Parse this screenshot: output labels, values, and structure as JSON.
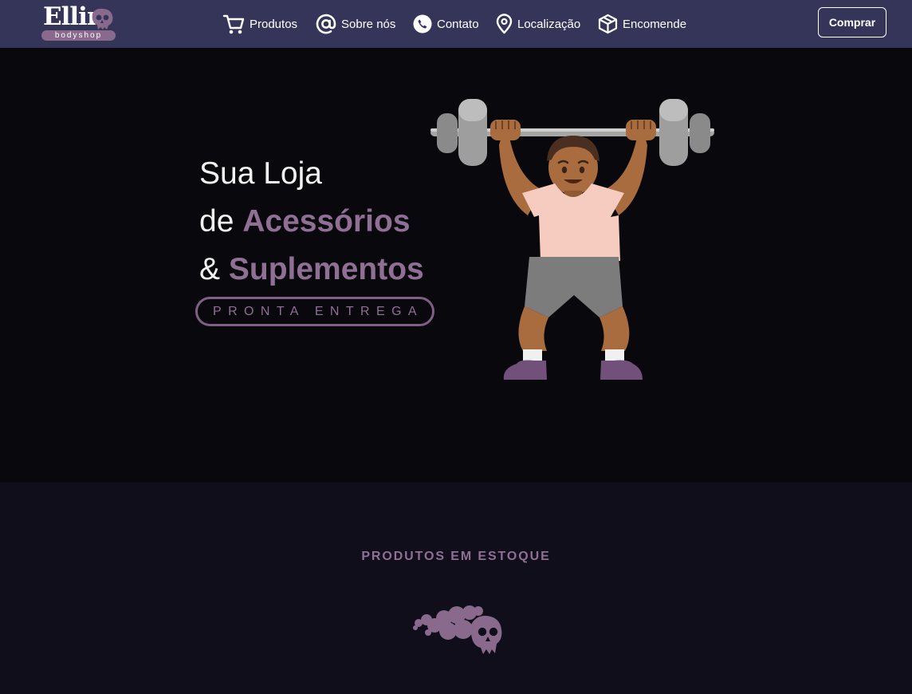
{
  "header": {
    "logo": {
      "word": "Ellin",
      "subtitle": "bodyshop"
    },
    "nav": [
      {
        "label": "Produtos",
        "icon": "shopping-cart-icon"
      },
      {
        "label": "Sobre nós",
        "icon": "at-sign-icon"
      },
      {
        "label": "Contato",
        "icon": "phone-icon"
      },
      {
        "label": "Localização",
        "icon": "map-pin-icon"
      },
      {
        "label": "Encomende",
        "icon": "package-icon"
      }
    ],
    "buy_label": "Comprar"
  },
  "hero": {
    "line1": "Sua Loja",
    "line2_prefix": "de",
    "line2_accent": "Acessórios",
    "line3_prefix": "&",
    "line3_accent": "Suplementos",
    "badge": "PRONTA ENTREGA",
    "illustration": "weightlifter-emoji"
  },
  "products": {
    "title": "PRODUTOS EM ESTOQUE",
    "loading_icon": "skull-smoke-icon"
  },
  "colors": {
    "header_bg": "#35355a",
    "hero_bg": "#09080c",
    "section_bg": "#0f0e1a",
    "accent": "#8f6f94"
  }
}
